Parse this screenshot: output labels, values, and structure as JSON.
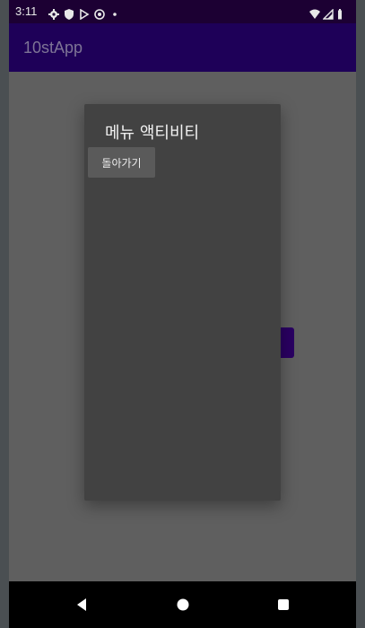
{
  "status_bar": {
    "time": "3:11",
    "left_icons": [
      "settings-icon",
      "shield-icon",
      "play-store-icon",
      "no-disturb-icon",
      "dot-icon"
    ],
    "right_icons": [
      "wifi-icon",
      "signal-icon",
      "battery-icon"
    ]
  },
  "app_bar": {
    "title": "10stApp"
  },
  "dialog": {
    "title": "메뉴 액티비티",
    "back_button_label": "돌아가기"
  },
  "nav_bar": {
    "icons": [
      "back-icon",
      "home-icon",
      "recents-icon"
    ]
  },
  "colors": {
    "status_bar": "#1c0033",
    "app_bar": "#1e0058",
    "scrim": "#5f5f5f",
    "dialog": "#424242",
    "button": "#5a5a5a"
  }
}
